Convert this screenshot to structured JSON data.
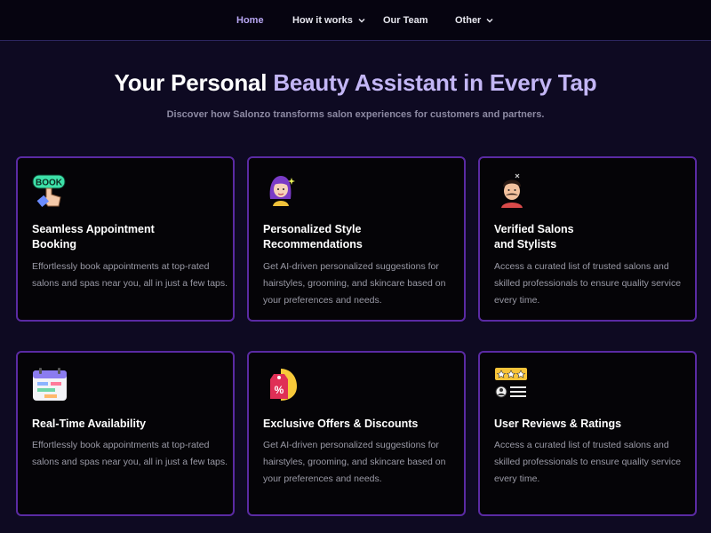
{
  "nav": {
    "items": [
      {
        "label": "Home",
        "active": true,
        "dropdown": false
      },
      {
        "label": "How it works",
        "active": false,
        "dropdown": true
      },
      {
        "label": "Our Team",
        "active": false,
        "dropdown": false
      },
      {
        "label": "Other",
        "active": false,
        "dropdown": true
      }
    ]
  },
  "hero": {
    "title_plain": "Your Personal ",
    "title_accent": "Beauty Assistant in Every Tap",
    "subtitle": "Discover how Salonzo transforms salon experiences for customers and partners."
  },
  "cards": [
    {
      "icon": "book-hand-icon",
      "title_line1": "Seamless Appointment",
      "title_line2": "Booking",
      "description": "Effortlessly book appointments at top-rated salons and spas near you, all in just a few taps."
    },
    {
      "icon": "stylist-woman-icon",
      "title_line1": "Personalized Style",
      "title_line2": "Recommendations",
      "description": " Get AI-driven personalized suggestions for hairstyles, grooming, and skincare based on your preferences and needs."
    },
    {
      "icon": "barber-man-icon",
      "title_line1": "Verified Salons",
      "title_line2": "and Stylists",
      "description": " Access a curated list of trusted salons and skilled professionals to ensure quality service every time."
    },
    {
      "icon": "calendar-icon",
      "title_line1": "Real-Time Availability",
      "title_line2": "",
      "description": "Effortlessly book appointments at top-rated salons and spas near you, all in just a few taps."
    },
    {
      "icon": "discount-tag-icon",
      "title_line1": "Exclusive Offers & Discounts",
      "title_line2": "",
      "description": " Get AI-driven personalized suggestions for hairstyles, grooming, and skincare based on your preferences and needs."
    },
    {
      "icon": "reviews-stars-icon",
      "title_line1": "User Reviews & Ratings",
      "title_line2": "",
      "description": " Access a curated list of trusted salons and skilled professionals to ensure quality service every time."
    }
  ],
  "icon_text": {
    "book": "BOOK",
    "percent": "%"
  },
  "colors": {
    "background": "#0e0a22",
    "accent": "#c3b6f5",
    "card_border": "#5a2aa3",
    "nav_active": "#b7a6f2"
  }
}
